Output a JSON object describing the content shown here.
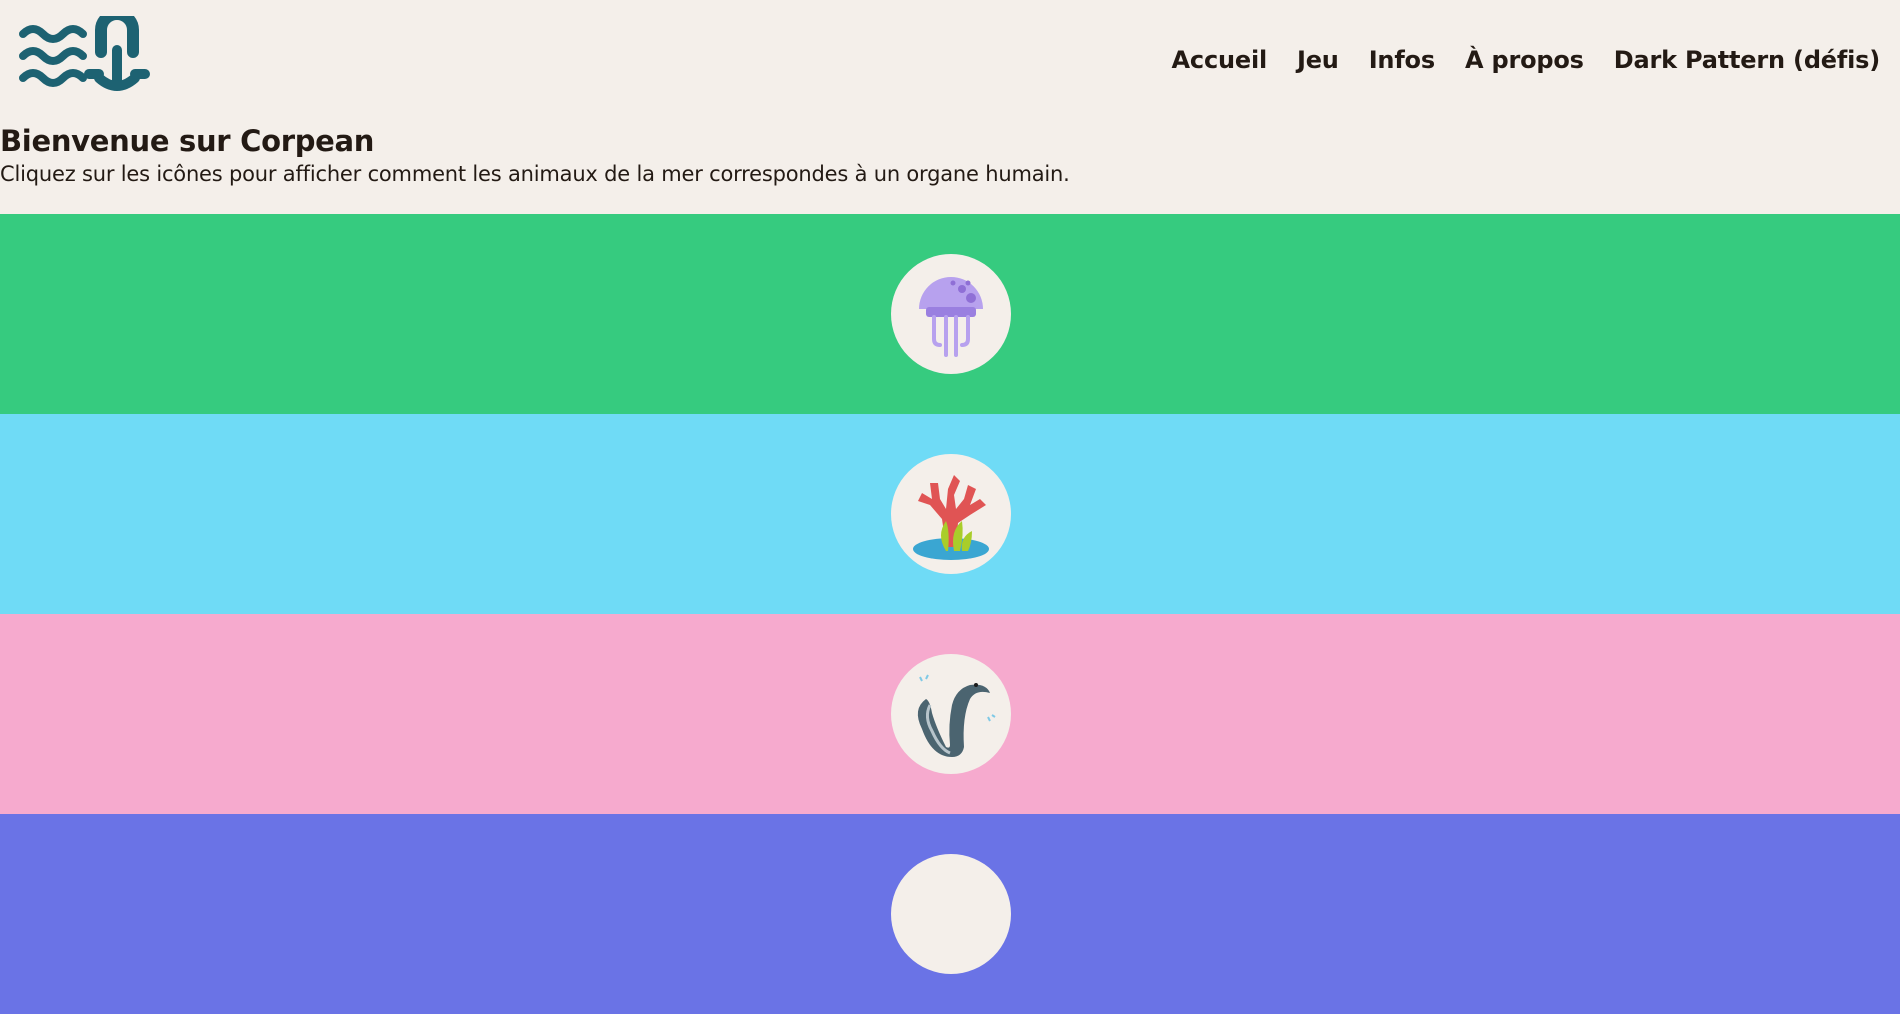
{
  "header": {
    "logo_icon": "waves-anchor-logo",
    "nav": [
      {
        "label": "Accueil"
      },
      {
        "label": "Jeu"
      },
      {
        "label": "Infos"
      },
      {
        "label": "À propos"
      },
      {
        "label": "Dark Pattern (défis)"
      }
    ]
  },
  "intro": {
    "title": "Bienvenue sur Corpean",
    "text": "Cliquez sur les icônes pour afficher comment les animaux de la mer correspondes à un organe humain."
  },
  "bands": [
    {
      "icon": "jellyfish-icon",
      "color": "#36cb7f"
    },
    {
      "icon": "coral-icon",
      "color": "#6fdbf6"
    },
    {
      "icon": "eel-icon",
      "color": "#f6aace"
    },
    {
      "icon": "unknown-icon",
      "color": "#6a73e6"
    }
  ],
  "colors": {
    "background": "#f4efea",
    "text": "#231a14",
    "logo": "#1d6272"
  }
}
